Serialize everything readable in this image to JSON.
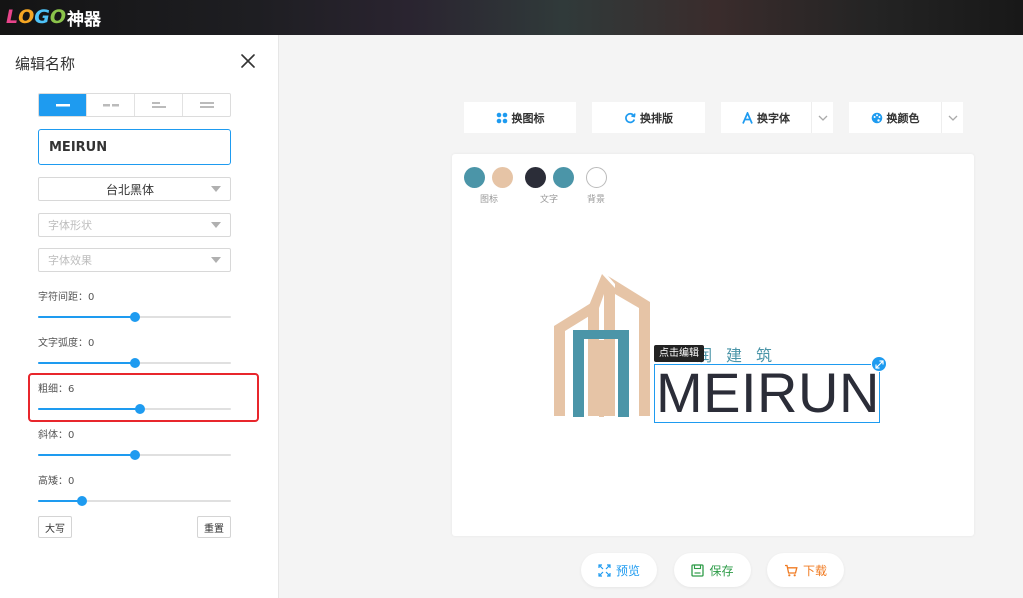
{
  "brand": {
    "letters": [
      "L",
      "O",
      "G",
      "O"
    ],
    "letter_colors": [
      "#e8448a",
      "#f5a623",
      "#4fc3f7",
      "#8bc34a"
    ],
    "suffix": "神器"
  },
  "panel": {
    "title": "编辑名称",
    "name_value": "MEIRUN",
    "font_select": "台北黑体",
    "font_shape_placeholder": "字体形状",
    "font_effect_placeholder": "字体效果",
    "sliders": [
      {
        "label": "字符间距：0",
        "percent": 50
      },
      {
        "label": "文字弧度：0",
        "percent": 50
      },
      {
        "label": "粗细：6",
        "percent": 53
      },
      {
        "label": "斜体：0",
        "percent": 50
      },
      {
        "label": "高矮：0",
        "percent": 23
      }
    ],
    "uppercase_label": "大写",
    "reset_label": "重置"
  },
  "toolbar": {
    "change_icon": "换图标",
    "change_layout": "换排版",
    "change_font": "换字体",
    "change_color": "换颜色"
  },
  "canvas": {
    "swatches": [
      {
        "color": "#4b95a8",
        "name": "icon-color-1"
      },
      {
        "color": "#e6c4a6",
        "name": "icon-color-2"
      },
      {
        "color": "#2b2d38",
        "name": "text-color-1"
      },
      {
        "color": "#4b95a8",
        "name": "text-color-2"
      },
      {
        "color": "#ffffff",
        "name": "background-color"
      }
    ],
    "swatch_labels": {
      "icon": "图标",
      "text": "文字",
      "background": "背景"
    },
    "chinese_name": "润建筑",
    "edit_tip": "点击编辑",
    "brand_text": "MEIRUN"
  },
  "actions": {
    "preview": "预览",
    "save": "保存",
    "download": "下载"
  },
  "colors": {
    "accent": "#1e9bf0",
    "highlight": "#e8262c",
    "save_green": "#2e9c48",
    "download_orange": "#f07b22"
  }
}
